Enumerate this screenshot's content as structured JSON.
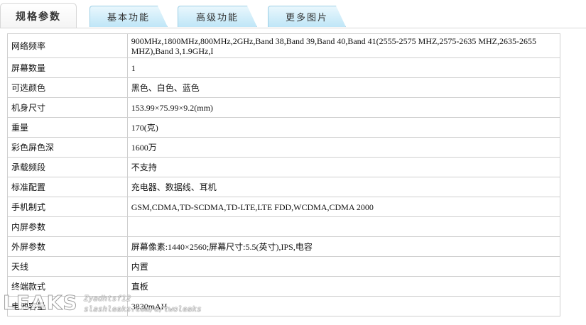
{
  "tabs": [
    {
      "label": "规格参数",
      "active": true
    },
    {
      "label": "基本功能",
      "active": false
    },
    {
      "label": "高级功能",
      "active": false
    },
    {
      "label": "更多图片",
      "active": false
    }
  ],
  "specs": [
    {
      "key": "网络频率",
      "value": "900MHz,1800MHz,800MHz,2GHz,Band 38,Band 39,Band 40,Band 41(2555-2575 MHZ,2575-2635 MHZ,2635-2655 MHZ),Band 3,1.9GHz,I"
    },
    {
      "key": "屏幕数量",
      "value": "1"
    },
    {
      "key": "可选颜色",
      "value": "黑色、白色、蓝色"
    },
    {
      "key": "机身尺寸",
      "value": "153.99×75.99×9.2(mm)"
    },
    {
      "key": "重量",
      "value": "170(克)"
    },
    {
      "key": "彩色屏色深",
      "value": "1600万"
    },
    {
      "key": "承载频段",
      "value": "不支持"
    },
    {
      "key": "标准配置",
      "value": "充电器、数据线、耳机"
    },
    {
      "key": "手机制式",
      "value": "GSM,CDMA,TD-SCDMA,TD-LTE,LTE FDD,WCDMA,CDMA 2000"
    },
    {
      "key": "内屏参数",
      "value": ""
    },
    {
      "key": "外屏参数",
      "value": "屏幕像素:1440×2560;屏幕尺寸:5.5(英寸),IPS,电容"
    },
    {
      "key": "天线",
      "value": "内置"
    },
    {
      "key": "终端款式",
      "value": "直板"
    },
    {
      "key": "电池容量",
      "value": "3830mAH"
    }
  ],
  "watermark": {
    "logo": "LEAKS",
    "user": "Zyadhtsf12",
    "url": "slashleaks.com/u/twoleaks"
  }
}
